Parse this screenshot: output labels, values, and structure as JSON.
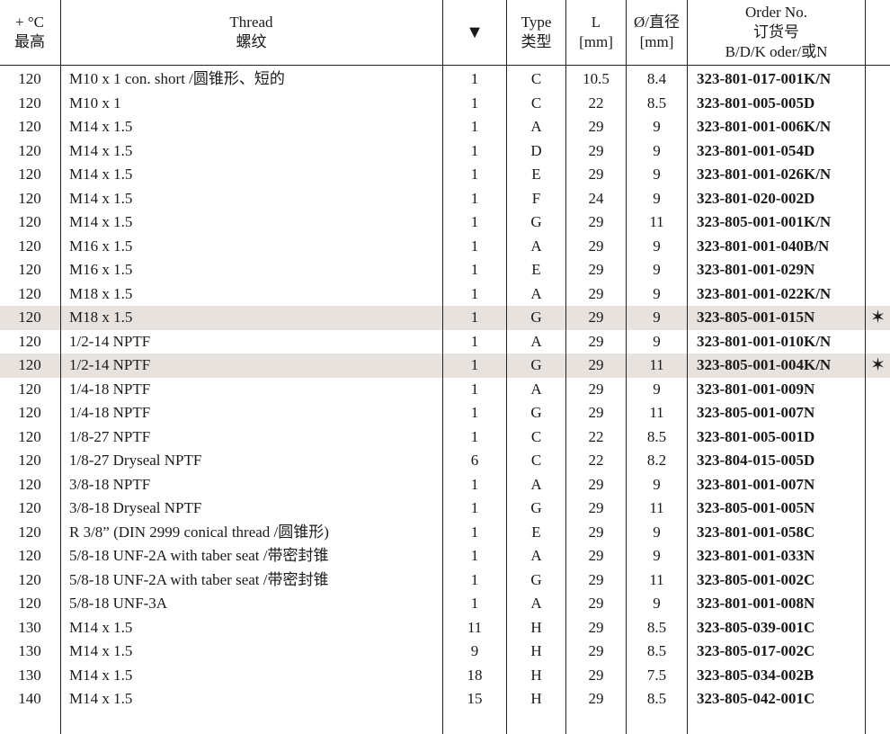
{
  "header": {
    "temp": [
      "+ °C",
      "最高"
    ],
    "thread": [
      "Thread",
      "螺纹"
    ],
    "triangle": "▼",
    "type": [
      "Type",
      "类型"
    ],
    "length": [
      "L",
      "[mm]"
    ],
    "diameter": [
      "Ø/直径",
      "[mm]"
    ],
    "order": [
      "Order No.",
      "订货号",
      "B/D/K oder/或N"
    ]
  },
  "rows": [
    {
      "temp": "120",
      "thread": "M10 x 1 con. short /圆锥形、短的",
      "qty": "1",
      "type": "C",
      "l": "10.5",
      "d": "8.4",
      "order": "323-801-017-001K/N",
      "star": "",
      "highlight": false
    },
    {
      "temp": "120",
      "thread": "M10 x 1",
      "qty": "1",
      "type": "C",
      "l": "22",
      "d": "8.5",
      "order": "323-801-005-005D",
      "star": "",
      "highlight": false
    },
    {
      "temp": "120",
      "thread": "M14 x 1.5",
      "qty": "1",
      "type": "A",
      "l": "29",
      "d": "9",
      "order": "323-801-001-006K/N",
      "star": "",
      "highlight": false
    },
    {
      "temp": "120",
      "thread": "M14 x 1.5",
      "qty": "1",
      "type": "D",
      "l": "29",
      "d": "9",
      "order": "323-801-001-054D",
      "star": "",
      "highlight": false
    },
    {
      "temp": "120",
      "thread": "M14 x 1.5",
      "qty": "1",
      "type": "E",
      "l": "29",
      "d": "9",
      "order": "323-801-001-026K/N",
      "star": "",
      "highlight": false
    },
    {
      "temp": "120",
      "thread": "M14 x 1.5",
      "qty": "1",
      "type": "F",
      "l": "24",
      "d": "9",
      "order": "323-801-020-002D",
      "star": "",
      "highlight": false
    },
    {
      "temp": "120",
      "thread": "M14 x 1.5",
      "qty": "1",
      "type": "G",
      "l": "29",
      "d": "11",
      "order": "323-805-001-001K/N",
      "star": "",
      "highlight": false
    },
    {
      "temp": "120",
      "thread": "M16 x 1.5",
      "qty": "1",
      "type": "A",
      "l": "29",
      "d": "9",
      "order": "323-801-001-040B/N",
      "star": "",
      "highlight": false
    },
    {
      "temp": "120",
      "thread": "M16 x 1.5",
      "qty": "1",
      "type": "E",
      "l": "29",
      "d": "9",
      "order": "323-801-001-029N",
      "star": "",
      "highlight": false
    },
    {
      "temp": "120",
      "thread": "M18 x 1.5",
      "qty": "1",
      "type": "A",
      "l": "29",
      "d": "9",
      "order": "323-801-001-022K/N",
      "star": "",
      "highlight": false
    },
    {
      "temp": "120",
      "thread": "M18 x 1.5",
      "qty": "1",
      "type": "G",
      "l": "29",
      "d": "9",
      "order": "323-805-001-015N",
      "star": "✶",
      "highlight": true
    },
    {
      "temp": "120",
      "thread": "1/2-14 NPTF",
      "qty": "1",
      "type": "A",
      "l": "29",
      "d": "9",
      "order": "323-801-001-010K/N",
      "star": "",
      "highlight": false
    },
    {
      "temp": "120",
      "thread": "1/2-14 NPTF",
      "qty": "1",
      "type": "G",
      "l": "29",
      "d": "11",
      "order": "323-805-001-004K/N",
      "star": "✶",
      "highlight": true
    },
    {
      "temp": "120",
      "thread": "1/4-18 NPTF",
      "qty": "1",
      "type": "A",
      "l": "29",
      "d": "9",
      "order": "323-801-001-009N",
      "star": "",
      "highlight": false
    },
    {
      "temp": "120",
      "thread": "1/4-18 NPTF",
      "qty": "1",
      "type": "G",
      "l": "29",
      "d": "11",
      "order": "323-805-001-007N",
      "star": "",
      "highlight": false
    },
    {
      "temp": "120",
      "thread": "1/8-27 NPTF",
      "qty": "1",
      "type": "C",
      "l": "22",
      "d": "8.5",
      "order": "323-801-005-001D",
      "star": "",
      "highlight": false
    },
    {
      "temp": "120",
      "thread": "1/8-27 Dryseal NPTF",
      "qty": "6",
      "type": "C",
      "l": "22",
      "d": "8.2",
      "order": "323-804-015-005D",
      "star": "",
      "highlight": false
    },
    {
      "temp": "120",
      "thread": "3/8-18 NPTF",
      "qty": "1",
      "type": "A",
      "l": "29",
      "d": "9",
      "order": "323-801-001-007N",
      "star": "",
      "highlight": false
    },
    {
      "temp": "120",
      "thread": "3/8-18 Dryseal NPTF",
      "qty": "1",
      "type": "G",
      "l": "29",
      "d": "11",
      "order": "323-805-001-005N",
      "star": "",
      "highlight": false
    },
    {
      "temp": "120",
      "thread": "R 3/8” (DIN 2999 conical thread /圆锥形)",
      "qty": "1",
      "type": "E",
      "l": "29",
      "d": "9",
      "order": "323-801-001-058C",
      "star": "",
      "highlight": false
    },
    {
      "temp": "120",
      "thread": "5/8-18 UNF-2A with taber seat /带密封锥",
      "qty": "1",
      "type": "A",
      "l": "29",
      "d": "9",
      "order": "323-801-001-033N",
      "star": "",
      "highlight": false
    },
    {
      "temp": "120",
      "thread": "5/8-18 UNF-2A with taber seat /带密封锥",
      "qty": "1",
      "type": "G",
      "l": "29",
      "d": "11",
      "order": "323-805-001-002C",
      "star": "",
      "highlight": false
    },
    {
      "temp": "120",
      "thread": "5/8-18 UNF-3A",
      "qty": "1",
      "type": "A",
      "l": "29",
      "d": "9",
      "order": "323-801-001-008N",
      "star": "",
      "highlight": false
    },
    {
      "temp": "130",
      "thread": "M14 x 1.5",
      "qty": "11",
      "type": "H",
      "l": "29",
      "d": "8.5",
      "order": "323-805-039-001C",
      "star": "",
      "highlight": false
    },
    {
      "temp": "130",
      "thread": "M14 x 1.5",
      "qty": "9",
      "type": "H",
      "l": "29",
      "d": "8.5",
      "order": "323-805-017-002C",
      "star": "",
      "highlight": false
    },
    {
      "temp": "130",
      "thread": "M14 x 1.5",
      "qty": "18",
      "type": "H",
      "l": "29",
      "d": "7.5",
      "order": "323-805-034-002B",
      "star": "",
      "highlight": false
    },
    {
      "temp": "140",
      "thread": "M14 x 1.5",
      "qty": "15",
      "type": "H",
      "l": "29",
      "d": "8.5",
      "order": "323-805-042-001C",
      "star": "",
      "highlight": false
    }
  ]
}
